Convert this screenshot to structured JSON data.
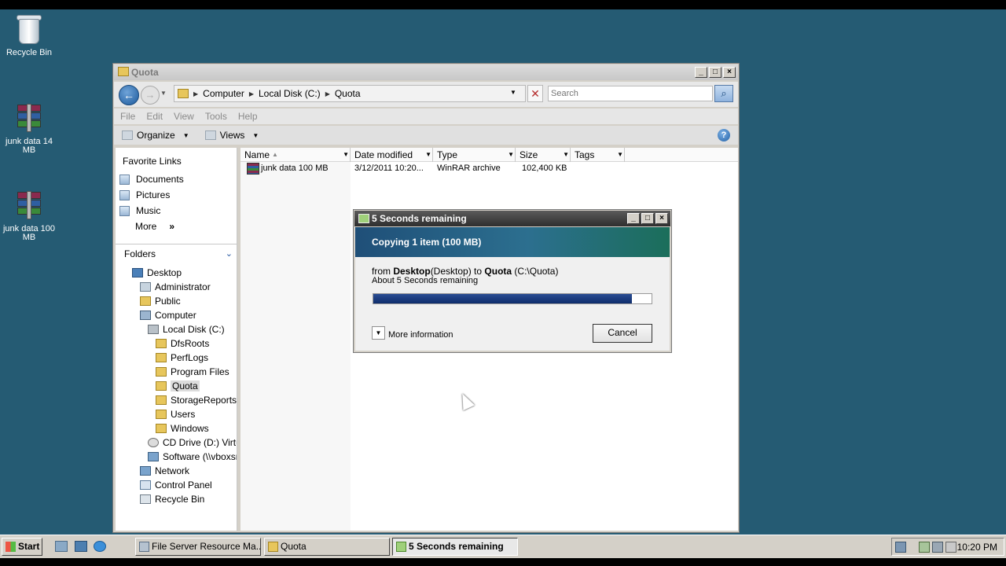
{
  "desktop": {
    "icons": [
      {
        "label": "Recycle Bin"
      },
      {
        "label": "junk data 14 MB"
      },
      {
        "label": "junk data 100 MB"
      }
    ]
  },
  "explorer": {
    "title": "Quota",
    "breadcrumb": [
      "Computer",
      "Local Disk (C:)",
      "Quota"
    ],
    "search_placeholder": "Search",
    "menu": [
      "File",
      "Edit",
      "View",
      "Tools",
      "Help"
    ],
    "toolbar": {
      "organize": "Organize",
      "views": "Views"
    },
    "favorites_title": "Favorite Links",
    "favorites": [
      "Documents",
      "Pictures",
      "Music"
    ],
    "favorites_more": "More",
    "folders_title": "Folders",
    "tree": [
      {
        "label": "Desktop",
        "icon": "desktop-icon",
        "indent": 0
      },
      {
        "label": "Administrator",
        "icon": "user-folder-icon",
        "indent": 1
      },
      {
        "label": "Public",
        "icon": "folder-icon",
        "indent": 1
      },
      {
        "label": "Computer",
        "icon": "computer-icon",
        "indent": 1
      },
      {
        "label": "Local Disk (C:)",
        "icon": "drive-icon",
        "indent": 2
      },
      {
        "label": "DfsRoots",
        "icon": "folder-icon",
        "indent": 3
      },
      {
        "label": "PerfLogs",
        "icon": "folder-icon",
        "indent": 3
      },
      {
        "label": "Program Files",
        "icon": "folder-icon",
        "indent": 3
      },
      {
        "label": "Quota",
        "icon": "folder-icon",
        "indent": 3,
        "selected": true
      },
      {
        "label": "StorageReports",
        "icon": "folder-icon",
        "indent": 3
      },
      {
        "label": "Users",
        "icon": "folder-icon",
        "indent": 3
      },
      {
        "label": "Windows",
        "icon": "folder-icon",
        "indent": 3
      },
      {
        "label": "CD Drive (D:) Virtua",
        "icon": "cd-drive-icon",
        "indent": 2
      },
      {
        "label": "Software (\\\\vboxsrv",
        "icon": "network-drive-icon",
        "indent": 2
      },
      {
        "label": "Network",
        "icon": "network-icon",
        "indent": 1
      },
      {
        "label": "Control Panel",
        "icon": "control-panel-icon",
        "indent": 1
      },
      {
        "label": "Recycle Bin",
        "icon": "recycle-bin-icon",
        "indent": 1
      }
    ],
    "columns": [
      "Name",
      "Date modified",
      "Type",
      "Size",
      "Tags"
    ],
    "files": [
      {
        "name": "junk data 100 MB",
        "date": "3/12/2011 10:20...",
        "type": "WinRAR archive",
        "size": "102,400 KB",
        "tags": ""
      }
    ]
  },
  "copy_dialog": {
    "title": "5 Seconds remaining",
    "heading": "Copying 1 item (100 MB)",
    "from_prefix": "from",
    "from_bold": "Desktop",
    "from_paren": "(Desktop)",
    "to_word": "to",
    "to_bold": "Quota",
    "to_paren": "(C:\\Quota)",
    "remaining": "About 5 Seconds remaining",
    "progress": 0.93,
    "more_info": "More information",
    "cancel": "Cancel"
  },
  "taskbar": {
    "start": "Start",
    "tasks": [
      {
        "label": "File Server Resource Ma..."
      },
      {
        "label": "Quota"
      },
      {
        "label": "5 Seconds remaining",
        "active": true
      }
    ],
    "clock": "10:20 PM"
  },
  "colors": {
    "desktop": "#255b73",
    "progress": "#0f2d6b",
    "banner": "#2c6f8f"
  }
}
